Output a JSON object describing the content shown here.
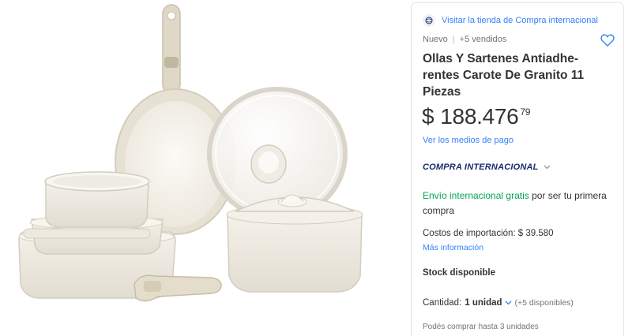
{
  "product": {
    "store_link": "Visitar la tienda de Compra internacional",
    "condition": "Nuevo",
    "separator": "|",
    "sold": "+5 vendidos",
    "title": "Ollas Y Sartenes Antiadhe-rentes Carote De Granito 11 Piezas",
    "price_currency": "$",
    "price_main": "188.476",
    "price_cents": "79",
    "payment_link": "Ver los medios de pago",
    "international_label": "COMPRA INTERNACIONAL",
    "shipping_green": "Envío internacional gratis",
    "shipping_rest": " por ser tu primera compra",
    "import_costs": "Costos de importación: $ 39.580",
    "more_info": "Más información",
    "stock": "Stock disponible",
    "quantity_label": "Cantidad:",
    "quantity_value": "1 unidad",
    "quantity_available": "(+5 disponibles)",
    "limit": "Podés comprar hasta 3 unidades"
  },
  "colors": {
    "link": "#3483fa",
    "green": "#00a650",
    "navy": "#1a2a6c",
    "cream": "#f1eee5"
  },
  "icons": {
    "store": "globe-icon",
    "favorite": "heart-icon",
    "chevron": "chevron-down-icon"
  }
}
